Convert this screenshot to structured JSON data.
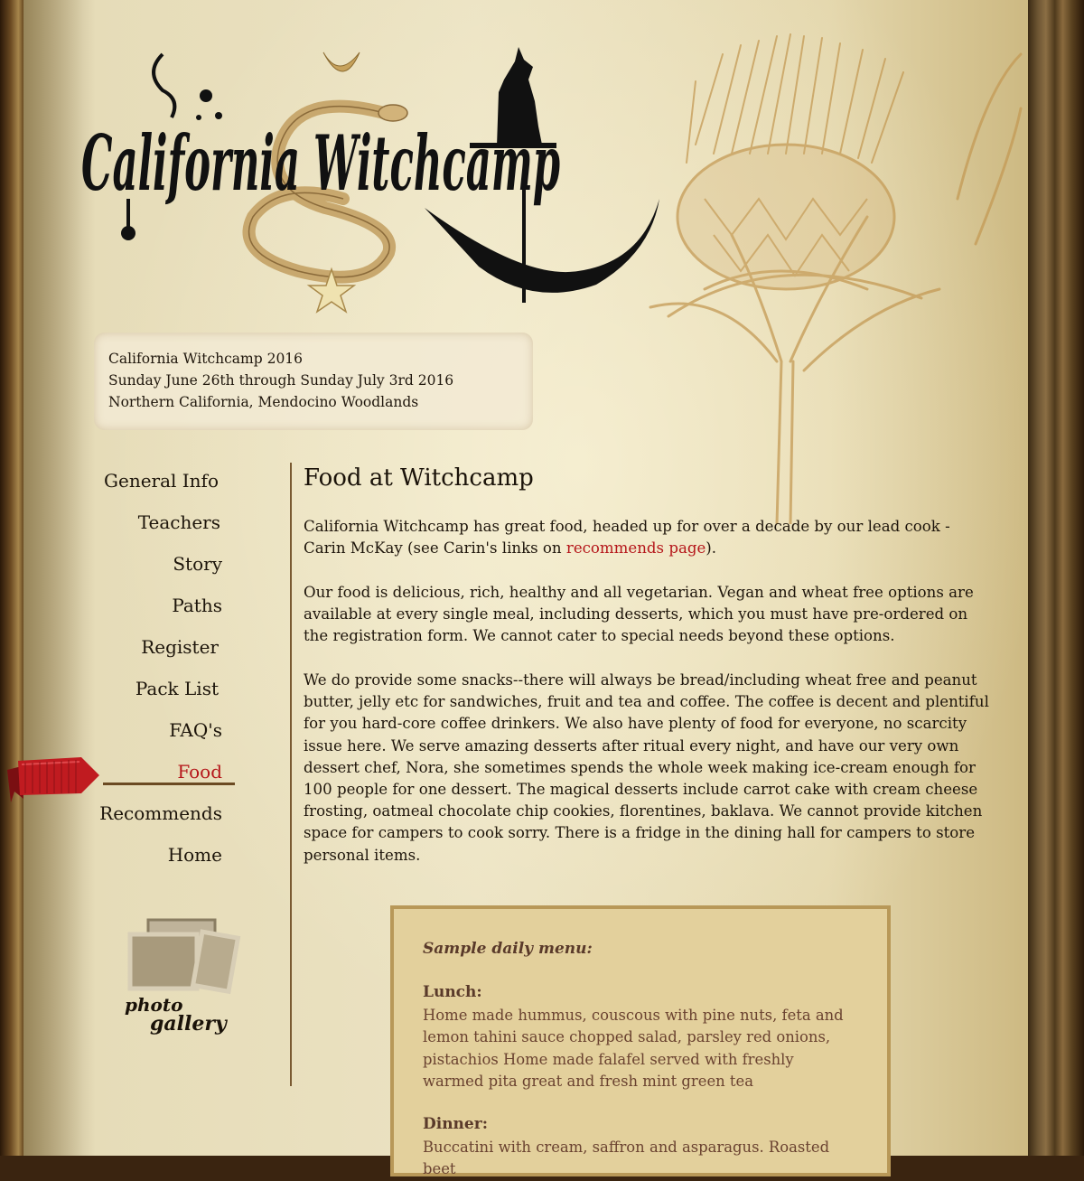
{
  "logo": {
    "text": "California Witchcamp"
  },
  "event": {
    "title": "California Witchcamp 2016",
    "dates": "Sunday June 26th through Sunday July 3rd 2016",
    "location": "Northern California, Mendocino Woodlands"
  },
  "nav": {
    "items": [
      {
        "label": "General Info"
      },
      {
        "label": "Teachers"
      },
      {
        "label": "Story"
      },
      {
        "label": "Paths"
      },
      {
        "label": "Register"
      },
      {
        "label": "Pack List"
      },
      {
        "label": "FAQ's"
      },
      {
        "label": "Food"
      },
      {
        "label": "Recommends"
      },
      {
        "label": "Home"
      }
    ],
    "active": "Food"
  },
  "gallery": {
    "line1": "photo",
    "line2": "gallery"
  },
  "content": {
    "title": "Food at Witchcamp",
    "p1_a": "California Witchcamp has great food, headed up for over a decade by our lead cook - Carin McKay (see Carin's links on ",
    "p1_link": "recommends page",
    "p1_b": ").",
    "p2": "Our food is delicious, rich, healthy and all vegetarian. Vegan and wheat free options are available at every single meal, including desserts, which you must have pre-ordered on the registration form. We cannot cater to special needs beyond these options.",
    "p3": "We do provide some snacks--there will always be bread/including wheat free and peanut butter, jelly etc for sandwiches, fruit and tea and coffee. The coffee is decent and plentiful for you hard-core coffee drinkers. We also have plenty of food for everyone, no scarcity issue here. We serve amazing desserts after ritual every night, and have our very own dessert chef, Nora, she sometimes spends the whole week making ice-cream enough for 100 people for one dessert. The magical desserts include carrot cake with cream cheese frosting, oatmeal chocolate chip cookies, florentines, baklava. We cannot provide kitchen space for campers to cook sorry. There is a fridge in the dining hall for campers to store personal items."
  },
  "menu": {
    "heading": "Sample daily menu:",
    "lunch_label": "Lunch:",
    "lunch_text": "Home made hummus, couscous with pine nuts, feta and lemon tahini sauce chopped salad, parsley red onions, pistachios Home made falafel served with freshly warmed pita great and fresh mint green tea",
    "dinner_label": "Dinner:",
    "dinner_text": "Buccatini with cream, saffron and asparagus. Roasted beet"
  },
  "colors": {
    "accent": "#b5161a",
    "parchment": "#ebe2c2",
    "menu_bg": "#e3d09c"
  }
}
